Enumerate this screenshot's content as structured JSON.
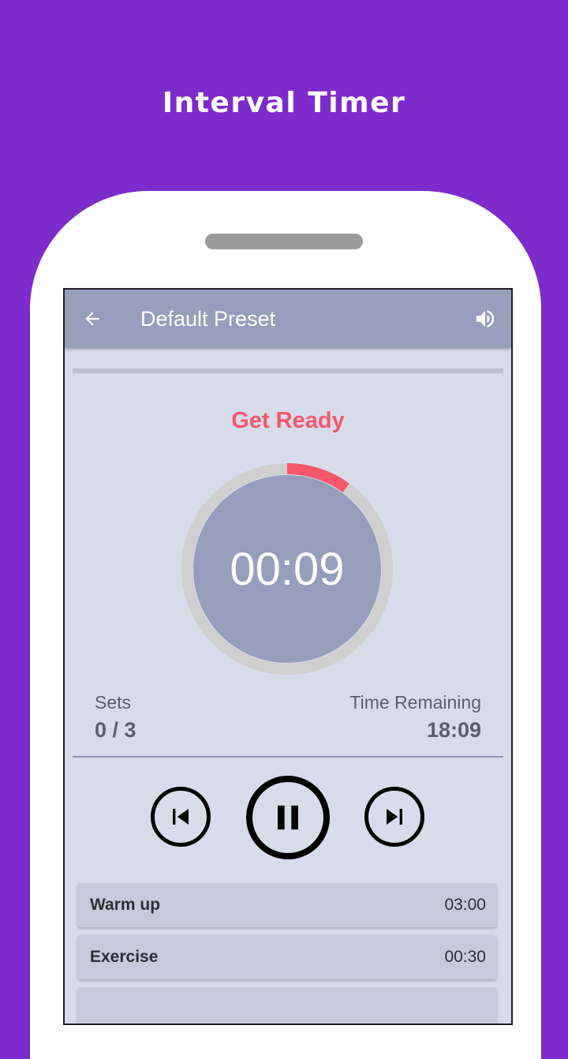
{
  "promo": {
    "headline": "Interval Timer"
  },
  "toolbar": {
    "title": "Default Preset",
    "back_icon": "arrow-left-icon",
    "sound_icon": "volume-icon"
  },
  "workout_progress": 0.0,
  "timer": {
    "phase": "Get Ready",
    "time": "00:09",
    "ring_progress": 0.1,
    "ring_color": "#f5576c",
    "track_color": "#cfcfcf"
  },
  "stats": {
    "sets_label": "Sets",
    "sets_value": "0 / 3",
    "remaining_label": "Time Remaining",
    "remaining_value": "18:09"
  },
  "controls": {
    "previous_icon": "skip-previous-icon",
    "pause_icon": "pause-icon",
    "next_icon": "skip-next-icon"
  },
  "intervals": [
    {
      "name": "Warm up",
      "duration": "03:00"
    },
    {
      "name": "Exercise",
      "duration": "00:30"
    },
    {
      "name": "",
      "duration": ""
    }
  ],
  "colors": {
    "background": "#7e2bcb",
    "accent": "#f5576c",
    "appbar": "#959fbb",
    "screen": "#d8dcea"
  }
}
